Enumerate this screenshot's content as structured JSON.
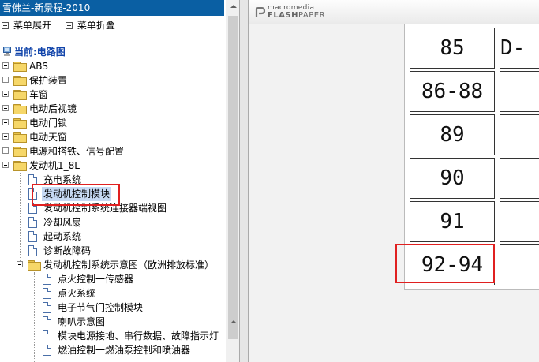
{
  "app": {
    "window_title": "雪佛兰-新景程-2010"
  },
  "menu": {
    "expand_label": "菜单展开",
    "collapse_label": "菜单折叠"
  },
  "tree": {
    "current_label": "当前:电路图",
    "folders": [
      {
        "label": "ABS"
      },
      {
        "label": "保护装置"
      },
      {
        "label": "车窗"
      },
      {
        "label": "电动后视镜"
      },
      {
        "label": "电动门锁"
      },
      {
        "label": "电动天窗"
      },
      {
        "label": "电源和搭铁、信号配置"
      }
    ],
    "engine": {
      "label": "发动机1_8L",
      "children": [
        {
          "label": "充电系统"
        },
        {
          "label": "发动机控制模块",
          "selected": true
        },
        {
          "label": "发动机控制系统连接器端视图"
        },
        {
          "label": "冷却风扇"
        },
        {
          "label": "起动系统"
        },
        {
          "label": "诊断故障码"
        }
      ],
      "subfolder": {
        "label": "发动机控制系统示意图（欧洲排放标准）",
        "children": [
          {
            "label": "点火控制一传感器"
          },
          {
            "label": "点火系统"
          },
          {
            "label": "电子节气门控制模块"
          },
          {
            "label": "喇叭示意图"
          },
          {
            "label": "模块电源接地、串行数据、故障指示灯"
          },
          {
            "label": "燃油控制一燃油泵控制和喷油器"
          }
        ]
      }
    }
  },
  "viewer": {
    "brand_top": "macromedia",
    "brand_bottom_bold": "FLASH",
    "brand_bottom_thin": "PAPER"
  },
  "document_table": {
    "rows": [
      {
        "left": "85",
        "right": "D-"
      },
      {
        "left": "86-88",
        "right": ""
      },
      {
        "left": "89",
        "right": ""
      },
      {
        "left": "90",
        "right": ""
      },
      {
        "left": "91",
        "right": ""
      },
      {
        "left": "92-94",
        "right": ""
      }
    ]
  },
  "colors": {
    "title_bar": "#0a5fa3",
    "selection": "#c6d9f3",
    "highlight_box": "#e02020",
    "current_label": "#1144aa"
  }
}
